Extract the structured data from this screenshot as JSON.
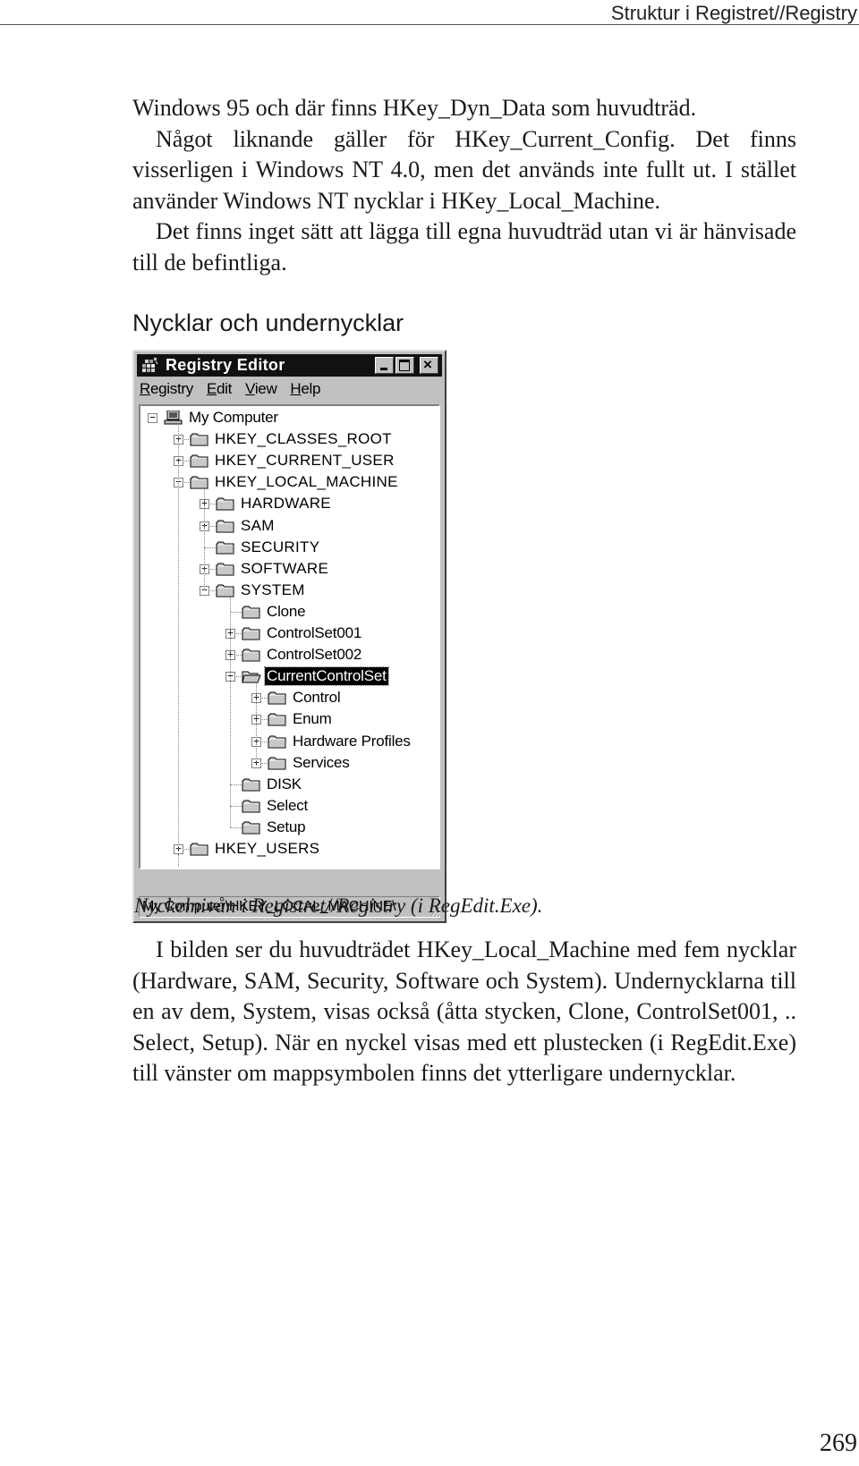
{
  "running_head": "Struktur i Registret//Registry",
  "paragraphs_top": [
    {
      "text": "Windows 95 och där finns HKey_Dyn_Data som huvudträd.",
      "indent": false
    },
    {
      "text": "Något liknande gäller för HKey_Current_Config. Det finns visserligen i Windows NT 4.0, men det används inte fullt ut. I stället använder Windows NT nycklar i HKey_Local_Machine.",
      "indent": true
    },
    {
      "text": "Det finns inget sätt att lägga till egna huvudträd utan vi är hänvisade till de befintliga.",
      "indent": true
    }
  ],
  "section_heading": "Nycklar och undernycklar",
  "registry_window": {
    "title": "Registry Editor",
    "menu": [
      {
        "label": "Registry",
        "accel": "R"
      },
      {
        "label": "Edit",
        "accel": "E"
      },
      {
        "label": "View",
        "accel": "V"
      },
      {
        "label": "Help",
        "accel": "H"
      }
    ],
    "tree": [
      {
        "label": "My Computer",
        "level": 0,
        "expander": "minus",
        "icon": "computer",
        "hkey": false
      },
      {
        "label": "HKEY_CLASSES_ROOT",
        "level": 1,
        "expander": "plus",
        "icon": "folder",
        "hkey": true
      },
      {
        "label": "HKEY_CURRENT_USER",
        "level": 1,
        "expander": "plus",
        "icon": "folder",
        "hkey": true
      },
      {
        "label": "HKEY_LOCAL_MACHINE",
        "level": 1,
        "expander": "minus",
        "icon": "folder",
        "hkey": true
      },
      {
        "label": "HARDWARE",
        "level": 2,
        "expander": "plus",
        "icon": "folder",
        "hkey": true
      },
      {
        "label": "SAM",
        "level": 2,
        "expander": "plus",
        "icon": "folder",
        "hkey": true
      },
      {
        "label": "SECURITY",
        "level": 2,
        "expander": "none",
        "icon": "folder",
        "hkey": true
      },
      {
        "label": "SOFTWARE",
        "level": 2,
        "expander": "plus",
        "icon": "folder",
        "hkey": true
      },
      {
        "label": "SYSTEM",
        "level": 2,
        "expander": "minus",
        "icon": "folder",
        "hkey": true
      },
      {
        "label": "Clone",
        "level": 3,
        "expander": "none",
        "icon": "folder",
        "hkey": false
      },
      {
        "label": "ControlSet001",
        "level": 3,
        "expander": "plus",
        "icon": "folder",
        "hkey": false
      },
      {
        "label": "ControlSet002",
        "level": 3,
        "expander": "plus",
        "icon": "folder",
        "hkey": false
      },
      {
        "label": "CurrentControlSet",
        "level": 3,
        "expander": "minus",
        "icon": "folder-open",
        "hkey": false,
        "selected": true
      },
      {
        "label": "Control",
        "level": 4,
        "expander": "plus",
        "icon": "folder",
        "hkey": false
      },
      {
        "label": "Enum",
        "level": 4,
        "expander": "plus",
        "icon": "folder",
        "hkey": false
      },
      {
        "label": "Hardware Profiles",
        "level": 4,
        "expander": "plus",
        "icon": "folder",
        "hkey": false
      },
      {
        "label": "Services",
        "level": 4,
        "expander": "plus",
        "icon": "folder",
        "hkey": false
      },
      {
        "label": "DISK",
        "level": 3,
        "expander": "none",
        "icon": "folder",
        "hkey": false
      },
      {
        "label": "Select",
        "level": 3,
        "expander": "none",
        "icon": "folder",
        "hkey": false
      },
      {
        "label": "Setup",
        "level": 3,
        "expander": "none",
        "icon": "folder",
        "hkey": false
      },
      {
        "label": "HKEY_USERS",
        "level": 1,
        "expander": "plus",
        "icon": "folder",
        "hkey": true
      }
    ],
    "status_path": "My Computer\\HKEY_LOCAL_MACHINE\\"
  },
  "caption": "Nyckelnivån i Registret//Registry (i RegEdit.Exe).",
  "paragraphs_bottom": [
    {
      "text": "I bilden ser du huvudträdet HKey_Local_Machine med fem nycklar (Hardware, SAM, Security, Software och System). Undernycklarna till en av dem, System, visas också (åtta stycken, Clone, ControlSet001, .. Select, Setup). När en nyckel visas med ett plustecken (i RegEdit.Exe) till vänster om mappsymbolen finns det ytterligare undernycklar.",
      "indent": true
    }
  ],
  "page_number": "269"
}
